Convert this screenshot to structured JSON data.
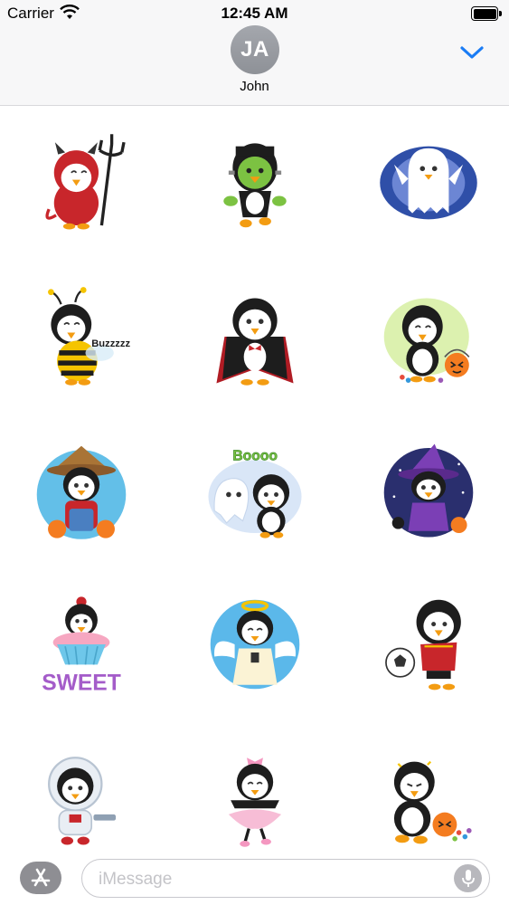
{
  "status_bar": {
    "carrier": "Carrier",
    "time": "12:45 AM"
  },
  "header": {
    "avatar_initials": "JA",
    "contact_name": "John"
  },
  "stickers": [
    {
      "name": "devil-penguin"
    },
    {
      "name": "frankenstein-penguin"
    },
    {
      "name": "ghost-penguin"
    },
    {
      "name": "bee-penguin",
      "text": "Buzzzzz"
    },
    {
      "name": "vampire-penguin"
    },
    {
      "name": "candy-bucket-penguin"
    },
    {
      "name": "scarecrow-penguin"
    },
    {
      "name": "boo-ghost-penguin",
      "text": "Boooo"
    },
    {
      "name": "witch-penguin"
    },
    {
      "name": "cupcake-penguin",
      "text": "SWEET"
    },
    {
      "name": "angel-penguin"
    },
    {
      "name": "soccer-penguin"
    },
    {
      "name": "astronaut-penguin"
    },
    {
      "name": "ballerina-penguin"
    },
    {
      "name": "spilled-candy-penguin"
    }
  ],
  "composer": {
    "placeholder": "iMessage"
  },
  "icons": {
    "app_store": "app-store-icon",
    "mic": "microphone-icon",
    "collapse": "chevron-down-icon",
    "wifi": "wifi-icon",
    "battery": "battery-icon"
  },
  "colors": {
    "accent": "#1a7cf5",
    "header_bg": "#f7f7f8",
    "avatar": "#9a9da3"
  }
}
